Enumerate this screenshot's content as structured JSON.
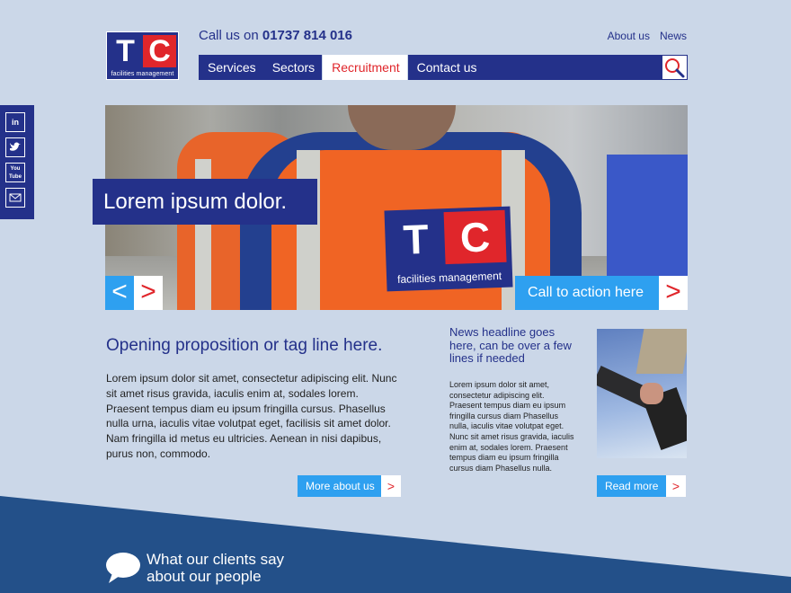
{
  "logo": {
    "letter_t": "T",
    "letter_c": "C",
    "subtitle": "facilities management"
  },
  "header": {
    "phone_prefix": "Call us on",
    "phone_number": "01737 814 016",
    "top_links": [
      "About us",
      "News"
    ]
  },
  "nav": {
    "items": [
      "Services",
      "Sectors",
      "Recruitment",
      "Contact us"
    ],
    "active": "Recruitment",
    "search_icon": "magnifier-icon"
  },
  "social": {
    "items": [
      {
        "label": "in",
        "icon": "linkedin-icon"
      },
      {
        "label": "t",
        "icon": "twitter-icon"
      },
      {
        "label": "You Tube",
        "icon": "youtube-icon"
      },
      {
        "label": "✉",
        "icon": "email-icon"
      }
    ]
  },
  "hero": {
    "caption": "Lorem ipsum dolor.",
    "prev_label": "<",
    "next_label": ">",
    "cta_label": "Call to action here",
    "cta_arrow": ">",
    "vest_t": "T",
    "vest_c": "C",
    "vest_sub": "facilities management"
  },
  "intro": {
    "tagline": "Opening proposition or tag line here.",
    "body": "Lorem ipsum dolor sit amet, consectetur adipiscing elit. Nunc sit amet risus gravida, iaculis enim at, sodales lorem. Praesent tempus diam eu ipsum fringilla cursus. Phasellus nulla urna, iaculis vitae volutpat eget, facilisis sit amet dolor. Nam fringilla id metus eu ultricies. Aenean in nisi dapibus, purus non, commodo.",
    "button_label": "More about us",
    "button_arrow": ">"
  },
  "news": {
    "headline": "News headline goes here, can be over a few lines if needed",
    "body": "Lorem ipsum dolor sit amet, consectetur adipiscing elit. Praesent tempus diam eu ipsum fringilla cursus diam Phasellus nulla, iaculis vitae volutpat eget. Nunc sit amet risus gravida, iaculis enim at, sodales lorem. Praesent tempus diam eu ipsum fringilla cursus diam Phasellus nulla.",
    "button_label": "Read more",
    "button_arrow": ">"
  },
  "testimonials": {
    "line1": "What our clients say",
    "line2": "about our people"
  },
  "colors": {
    "background": "#cbd7e8",
    "navy": "#24318a",
    "red": "#e0262b",
    "light_blue": "#2ea0f0",
    "footer_band": "#235089"
  }
}
